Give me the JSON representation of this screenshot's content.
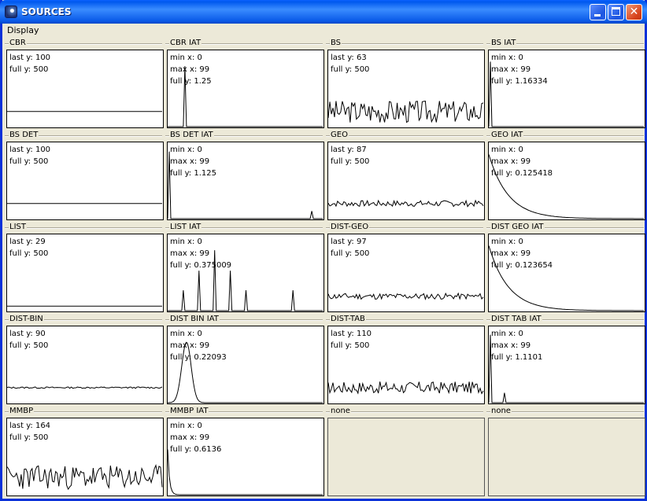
{
  "window": {
    "title": "SOURCES",
    "menu": [
      "Display"
    ]
  },
  "cells": [
    {
      "name": "CBR",
      "info": [
        "last y: 100",
        "full y: 500"
      ],
      "plot": {
        "kind": "flat",
        "level": 0.2
      }
    },
    {
      "name": "CBR IAT",
      "info": [
        "min x: 0",
        "max x: 99",
        "full y: 1.25"
      ],
      "plot": {
        "kind": "spikes",
        "points": [
          [
            11,
            0.8
          ]
        ]
      }
    },
    {
      "name": "BS",
      "info": [
        "last y: 63",
        "full y: 500"
      ],
      "plot": {
        "kind": "noise",
        "mean": 0.2,
        "amp": 0.15,
        "seed": 3
      }
    },
    {
      "name": "BS IAT",
      "info": [
        "min x: 0",
        "max x: 99",
        "full y: 1.16334"
      ],
      "plot": {
        "kind": "spikes",
        "points": [
          [
            1,
            0.86
          ]
        ]
      }
    },
    {
      "name": "BS DET",
      "info": [
        "last y: 100",
        "full y: 500"
      ],
      "plot": {
        "kind": "flat",
        "level": 0.2
      }
    },
    {
      "name": "BS DET IAT",
      "info": [
        "min x: 0",
        "max x: 99",
        "full y: 1.125"
      ],
      "plot": {
        "kind": "spikes",
        "points": [
          [
            1,
            0.89
          ],
          [
            92,
            0.1
          ]
        ]
      }
    },
    {
      "name": "GEO",
      "info": [
        "last y: 87",
        "full y: 500"
      ],
      "plot": {
        "kind": "noise",
        "mean": 0.2,
        "amp": 0.04,
        "seed": 7
      }
    },
    {
      "name": "GEO IAT",
      "info": [
        "min x: 0",
        "max x: 99",
        "full y: 0.125418"
      ],
      "plot": {
        "kind": "exp",
        "start": 0.85,
        "rate": 0.08
      }
    },
    {
      "name": "LIST",
      "info": [
        "last y: 29",
        "full y: 500"
      ],
      "plot": {
        "kind": "flat",
        "level": 0.06
      }
    },
    {
      "name": "LIST IAT",
      "info": [
        "min x: 0",
        "max x: 99",
        "full y: 0.375009"
      ],
      "plot": {
        "kind": "spikes",
        "points": [
          [
            10,
            0.27
          ],
          [
            20,
            0.53
          ],
          [
            30,
            0.8
          ],
          [
            40,
            0.53
          ],
          [
            50,
            0.27
          ],
          [
            80,
            0.27
          ]
        ]
      }
    },
    {
      "name": "DIST-GEO",
      "info": [
        "last y: 97",
        "full y: 500"
      ],
      "plot": {
        "kind": "noise",
        "mean": 0.19,
        "amp": 0.04,
        "seed": 11
      }
    },
    {
      "name": "DIST GEO IAT",
      "info": [
        "min x: 0",
        "max x: 99",
        "full y: 0.123654"
      ],
      "plot": {
        "kind": "exp",
        "start": 0.86,
        "rate": 0.08
      }
    },
    {
      "name": "DIST-BIN",
      "info": [
        "last y: 90",
        "full y: 500"
      ],
      "plot": {
        "kind": "noise",
        "mean": 0.2,
        "amp": 0.01,
        "seed": 13
      }
    },
    {
      "name": "DIST BIN IAT",
      "info": [
        "min x: 0",
        "max x: 99",
        "full y: 0.22093"
      ],
      "plot": {
        "kind": "bell",
        "mu": 12,
        "sigma": 3,
        "peak": 0.8
      }
    },
    {
      "name": "DIST-TAB",
      "info": [
        "last y: 110",
        "full y: 500"
      ],
      "plot": {
        "kind": "noise",
        "mean": 0.2,
        "amp": 0.08,
        "seed": 17
      }
    },
    {
      "name": "DIST TAB IAT",
      "info": [
        "min x: 0",
        "max x: 99",
        "full y: 1.1101"
      ],
      "plot": {
        "kind": "spikes",
        "points": [
          [
            1,
            0.9
          ],
          [
            10,
            0.13
          ]
        ]
      }
    },
    {
      "name": "MMBP",
      "info": [
        "last y: 164",
        "full y: 500"
      ],
      "plot": {
        "kind": "noise",
        "mean": 0.23,
        "amp": 0.16,
        "seed": 23
      }
    },
    {
      "name": "MMBP IAT",
      "info": [
        "min x: 0",
        "max x: 99",
        "full y: 0.6136"
      ],
      "plot": {
        "kind": "exp",
        "start": 0.6,
        "rate": 0.9
      }
    },
    {
      "name": "none",
      "info": [],
      "plot": {
        "kind": "none"
      }
    },
    {
      "name": "none",
      "info": [],
      "plot": {
        "kind": "none"
      }
    }
  ]
}
